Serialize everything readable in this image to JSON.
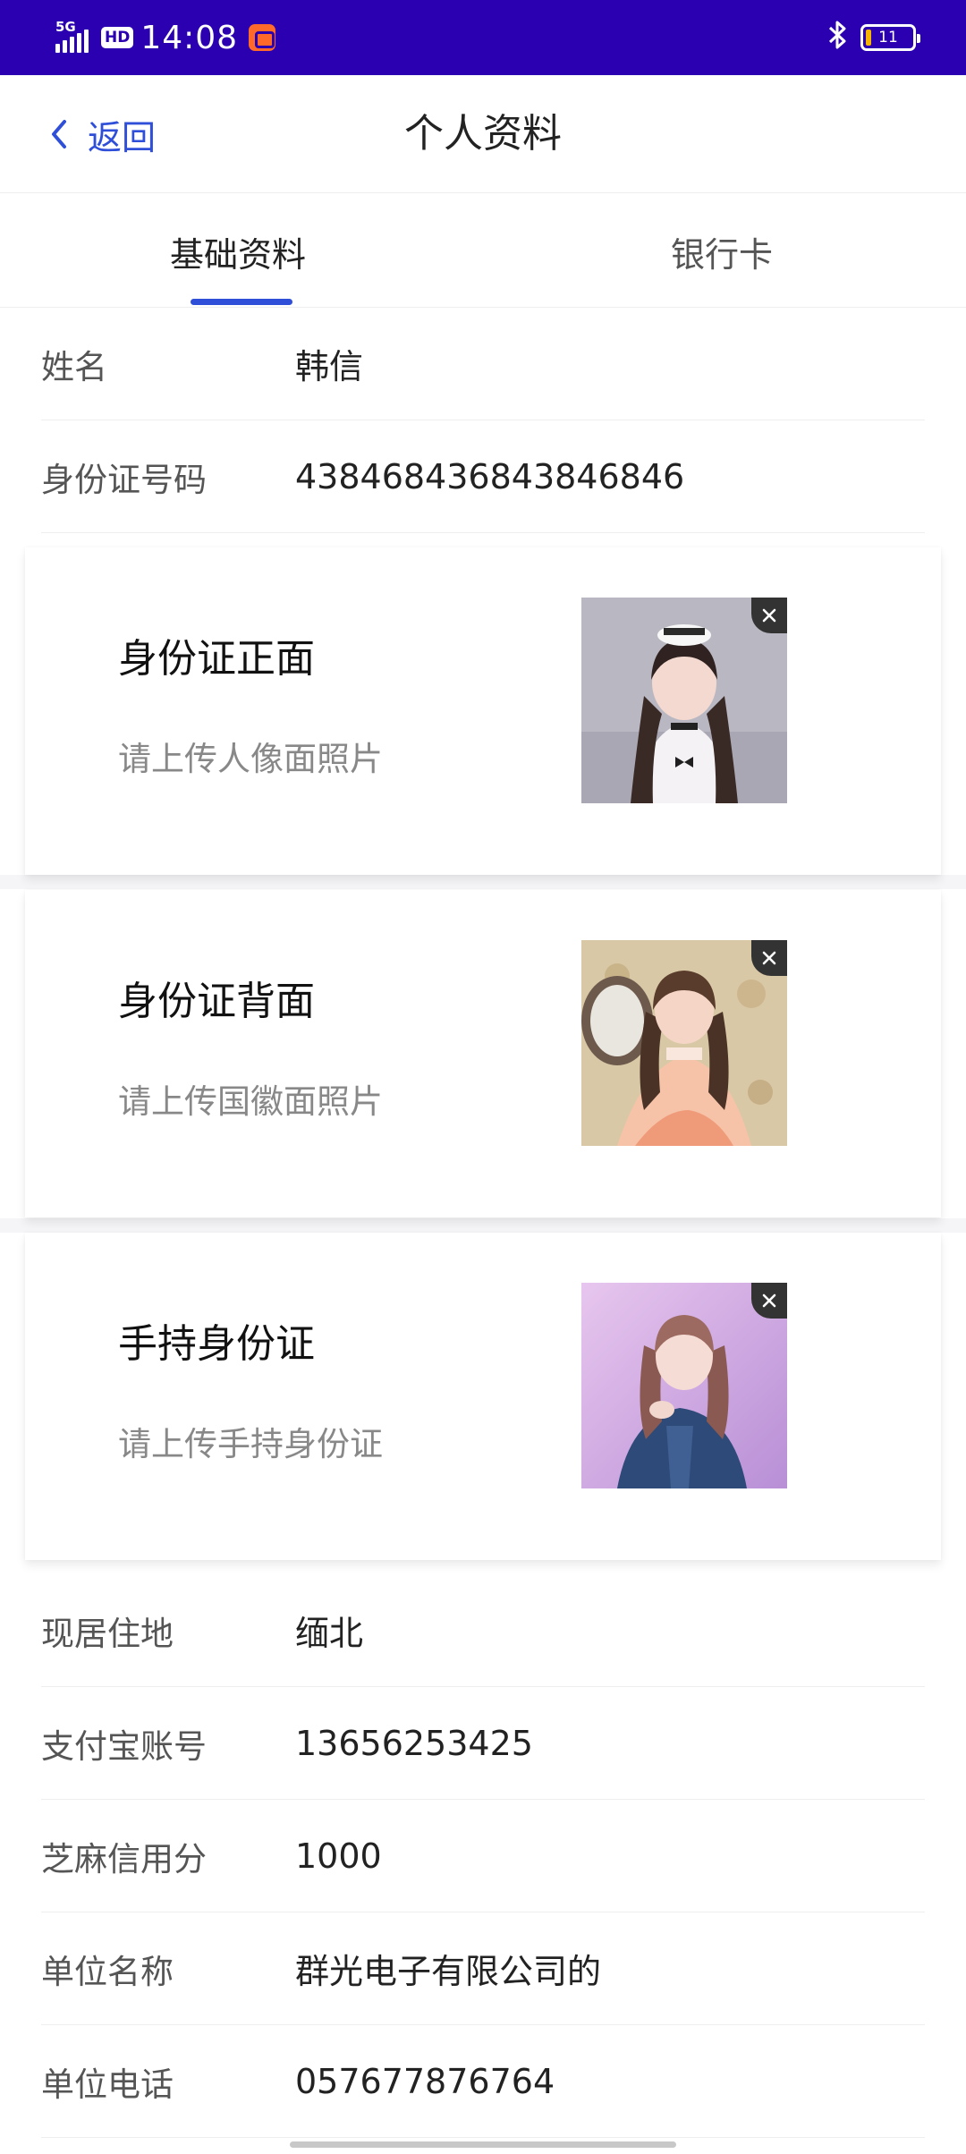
{
  "status_bar": {
    "network": "5G",
    "hd": "HD",
    "time": "14:08",
    "battery": "11",
    "bluetooth_icon": "bluetooth-icon",
    "background_color": "#2a00b0"
  },
  "nav": {
    "back_label": "返回",
    "title": "个人资料",
    "accent_color": "#2f4fd8"
  },
  "tabs": [
    {
      "label": "基础资料",
      "active": true
    },
    {
      "label": "银行卡",
      "active": false
    }
  ],
  "fields_top": [
    {
      "label": "姓名",
      "value": "韩信"
    },
    {
      "label": "身份证号码",
      "value": "438468436843846846"
    }
  ],
  "id_cards": [
    {
      "title": "身份证正面",
      "hint": "请上传人像面照片",
      "image": "portrait-photo-white-dress"
    },
    {
      "title": "身份证背面",
      "hint": "请上传国徽面照片",
      "image": "portrait-photo-floral-background"
    },
    {
      "title": "手持身份证",
      "hint": "请上传手持身份证",
      "image": "portrait-photo-denim-jacket"
    }
  ],
  "fields_bottom": [
    {
      "label": "现居住地",
      "value": "缅北"
    },
    {
      "label": "支付宝账号",
      "value": "13656253425"
    },
    {
      "label": "芝麻信用分",
      "value": "1000"
    },
    {
      "label": "单位名称",
      "value": "群光电子有限公司的"
    },
    {
      "label": "单位电话",
      "value": "057677876764"
    }
  ]
}
